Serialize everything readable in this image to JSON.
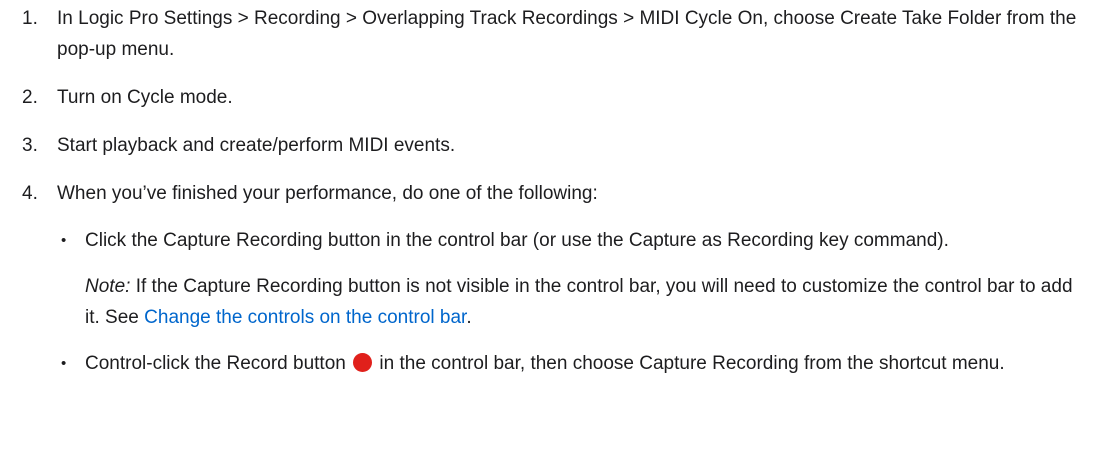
{
  "steps": [
    {
      "number": "1.",
      "text": "In Logic Pro Settings > Recording > Overlapping Track Recordings > MIDI Cycle On, choose Create Take Folder from the pop-up menu."
    },
    {
      "number": "2.",
      "text": "Turn on Cycle mode."
    },
    {
      "number": "3.",
      "text": "Start playback and create/perform MIDI events."
    },
    {
      "number": "4.",
      "text": "When you’ve finished your performance, do one of the following:"
    }
  ],
  "options": [
    {
      "bullet": "•",
      "text": "Click the Capture Recording button in the control bar (or use the Capture as Recording key command).",
      "note_label": "Note:",
      "note_text": " If the Capture Recording button is not visible in the control bar, you will need to customize the control bar to add it. See ",
      "note_link": "Change the controls on the control bar",
      "note_end": "."
    },
    {
      "bullet": "•",
      "text_before": "Control-click the Record button ",
      "icon": "record-icon",
      "text_after": " in the control bar, then choose Capture Recording from the shortcut menu."
    }
  ],
  "colors": {
    "text": "#1d1d1f",
    "link": "#0066cc",
    "record": "#e0201b"
  }
}
